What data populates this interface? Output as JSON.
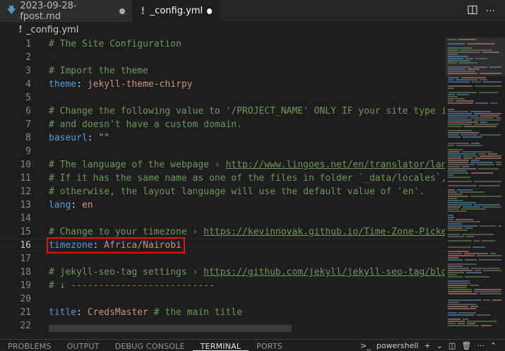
{
  "tabs": [
    {
      "icon": "markdown-icon",
      "icon_glyph": "🡇",
      "label": "2023-09-28-fpost.md",
      "modified": true,
      "active": false
    },
    {
      "icon": "yaml-icon",
      "icon_glyph": "!",
      "label": "_config.yml",
      "modified": true,
      "active": true
    }
  ],
  "breadcrumb": {
    "icon_glyph": "!",
    "file": "_config.yml"
  },
  "editor": {
    "current_line": 16,
    "lines": [
      {
        "n": "1",
        "tokens": [
          {
            "t": "# The Site Configuration",
            "c": "comment"
          }
        ]
      },
      {
        "n": "2",
        "tokens": []
      },
      {
        "n": "3",
        "tokens": [
          {
            "t": "# Import the theme",
            "c": "comment"
          }
        ]
      },
      {
        "n": "4",
        "tokens": [
          {
            "t": "theme",
            "c": "key"
          },
          {
            "t": ": ",
            "c": "plain"
          },
          {
            "t": "jekyll-theme-chirpy",
            "c": "str"
          }
        ]
      },
      {
        "n": "5",
        "tokens": []
      },
      {
        "n": "6",
        "tokens": [
          {
            "t": "# Change the following value to '/PROJECT_NAME' ONLY IF your site type is",
            "c": "comment"
          }
        ]
      },
      {
        "n": "7",
        "tokens": [
          {
            "t": "# and doesn't have a custom domain.",
            "c": "comment"
          }
        ]
      },
      {
        "n": "8",
        "tokens": [
          {
            "t": "baseurl",
            "c": "key"
          },
          {
            "t": ": ",
            "c": "plain"
          },
          {
            "t": "\"\"",
            "c": "str"
          }
        ]
      },
      {
        "n": "9",
        "tokens": []
      },
      {
        "n": "10",
        "tokens": [
          {
            "t": "# The language of the webpage › ",
            "c": "comment"
          },
          {
            "t": "http://www.lingoes.net/en/translator/lang",
            "c": "link"
          }
        ]
      },
      {
        "n": "11",
        "tokens": [
          {
            "t": "# If it has the same name as one of the files in folder `_data/locales`,",
            "c": "comment"
          }
        ]
      },
      {
        "n": "12",
        "tokens": [
          {
            "t": "# otherwise, the layout language will use the default value of 'en'.",
            "c": "comment"
          }
        ]
      },
      {
        "n": "13",
        "tokens": [
          {
            "t": "lang",
            "c": "key"
          },
          {
            "t": ": ",
            "c": "plain"
          },
          {
            "t": "en",
            "c": "str"
          }
        ]
      },
      {
        "n": "14",
        "tokens": []
      },
      {
        "n": "15",
        "tokens": [
          {
            "t": "# Change to your timezone › ",
            "c": "comment"
          },
          {
            "t": "https://kevinnovak.github.io/Time-Zone-Picker",
            "c": "link"
          }
        ]
      },
      {
        "n": "16",
        "tokens": [
          {
            "t": "timezone",
            "c": "key"
          },
          {
            "t": ": ",
            "c": "plain"
          },
          {
            "t": "Africa/Nairobi",
            "c": "str"
          }
        ]
      },
      {
        "n": "17",
        "tokens": []
      },
      {
        "n": "18",
        "tokens": [
          {
            "t": "# jekyll-seo-tag settings › ",
            "c": "comment"
          },
          {
            "t": "https://github.com/jekyll/jekyll-seo-tag/blob",
            "c": "link"
          }
        ]
      },
      {
        "n": "19",
        "tokens": [
          {
            "t": "# ↓ --------------------------",
            "c": "comment"
          }
        ]
      },
      {
        "n": "20",
        "tokens": []
      },
      {
        "n": "21",
        "tokens": [
          {
            "t": "title",
            "c": "key"
          },
          {
            "t": ": ",
            "c": "plain"
          },
          {
            "t": "CredsMaster",
            "c": "str"
          },
          {
            "t": " # the main title",
            "c": "comment"
          }
        ]
      },
      {
        "n": "22",
        "tokens": []
      }
    ]
  },
  "panel": {
    "tabs": [
      "PROBLEMS",
      "OUTPUT",
      "DEBUG CONSOLE",
      "TERMINAL",
      "PORTS"
    ],
    "active_tab": "TERMINAL",
    "terminal_name": "powershell"
  },
  "colors": {
    "highlight_border": "#e51400",
    "comment": "#6a9955",
    "key": "#569cd6",
    "string": "#ce9178"
  }
}
